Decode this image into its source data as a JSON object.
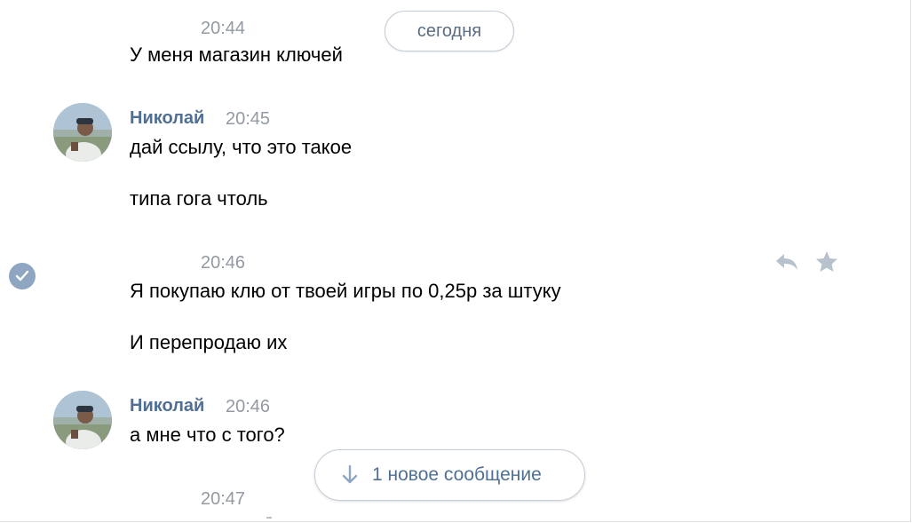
{
  "date_separator": "сегодня",
  "messages": [
    {
      "time": "20:44",
      "text": "У меня магазин ключей"
    },
    {
      "author": "Николай",
      "time": "20:45",
      "lines": [
        "дай ссылу, что это такое",
        "типа гога чтоль"
      ]
    },
    {
      "time": "20:46",
      "lines": [
        "Я покупаю клю от твоей игры по 0,25р за штуку",
        "И перепродаю их"
      ]
    },
    {
      "author": "Николай",
      "time": "20:46",
      "text": "а мне что с того?"
    },
    {
      "time": "20:47"
    }
  ],
  "actions": {
    "reply_icon": "reply-icon",
    "favorite_icon": "star-icon"
  },
  "new_messages": {
    "label": "1 новое сообщение",
    "icon": "arrow-down-icon"
  },
  "colors": {
    "author": "#4f6f94",
    "time": "#939aa3",
    "pill_border": "#c5cdd6",
    "check_badge": "#8ea6c1"
  }
}
